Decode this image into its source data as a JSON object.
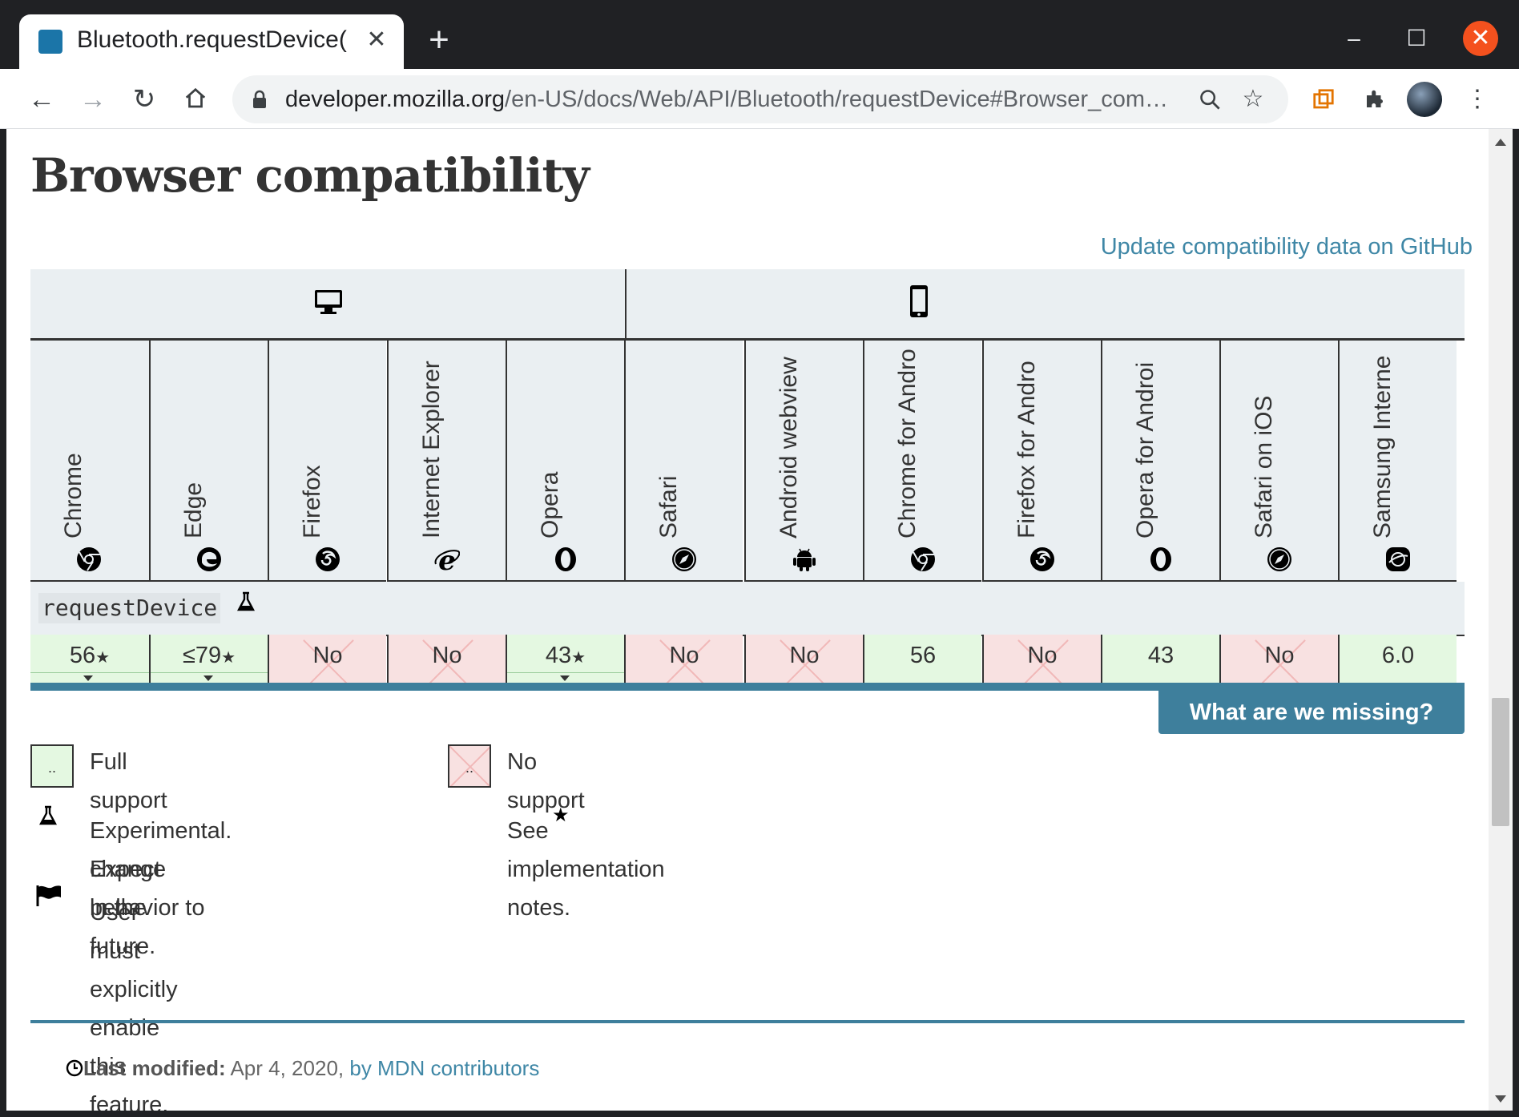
{
  "browser": {
    "tab_title": "Bluetooth.requestDevice(",
    "tab_close": "✕",
    "new_tab": "+",
    "minimize": "–",
    "maximize": "☐",
    "close": "✕",
    "url_host": "developer.mozilla.org",
    "url_path": "/en-US/docs/Web/API/Bluetooth/requestDevice#Browser_com…"
  },
  "page": {
    "title": "Browser compatibility",
    "github_link": "Update compatibility data on GitHub",
    "feature_name": "requestDevice",
    "missing_button": "What are we missing?"
  },
  "browsers": [
    {
      "name": "Chrome",
      "icon": "chrome-icon",
      "value": "56",
      "support": "yes",
      "notes": true
    },
    {
      "name": "Edge",
      "icon": "edge-icon",
      "value": "≤79",
      "support": "yes",
      "notes": true
    },
    {
      "name": "Firefox",
      "icon": "firefox-icon",
      "value": "No",
      "support": "no",
      "notes": false
    },
    {
      "name": "Internet Explorer",
      "icon": "ie-icon",
      "value": "No",
      "support": "no",
      "notes": false
    },
    {
      "name": "Opera",
      "icon": "opera-icon",
      "value": "43",
      "support": "yes",
      "notes": true
    },
    {
      "name": "Safari",
      "icon": "safari-icon",
      "value": "No",
      "support": "no",
      "notes": false
    },
    {
      "name": "Android webview",
      "icon": "android-icon",
      "value": "No",
      "support": "no",
      "notes": false
    },
    {
      "name": "Chrome for Andro",
      "icon": "chrome-icon",
      "value": "56",
      "support": "yes",
      "notes": false
    },
    {
      "name": "Firefox for Andro",
      "icon": "firefox-icon",
      "value": "No",
      "support": "no",
      "notes": false
    },
    {
      "name": "Opera for Androi",
      "icon": "opera-icon",
      "value": "43",
      "support": "yes",
      "notes": false
    },
    {
      "name": "Safari on iOS",
      "icon": "safari-icon",
      "value": "No",
      "support": "no",
      "notes": false
    },
    {
      "name": "Samsung Interne",
      "icon": "samsung-internet-icon",
      "value": "6.0",
      "support": "yes",
      "notes": false
    }
  ],
  "legend": {
    "full_support": "Full support",
    "no_support": "No support",
    "box_glyph": "..",
    "experimental_1": "Experimental. Expect behavior to",
    "experimental_2": "change in the future.",
    "flag": "User must explicitly enable this feature.",
    "notes_star": "★",
    "notes": "See implementation notes."
  },
  "footer": {
    "last_modified_label": "Last modified:",
    "last_modified_date": "Apr 4, 2020,",
    "contributors": "by MDN contributors"
  },
  "colors": {
    "yes_bg": "#e4f8e1",
    "no_bg": "#f8e1e1",
    "accent": "#3e7f9c",
    "link": "#3f87a6"
  }
}
